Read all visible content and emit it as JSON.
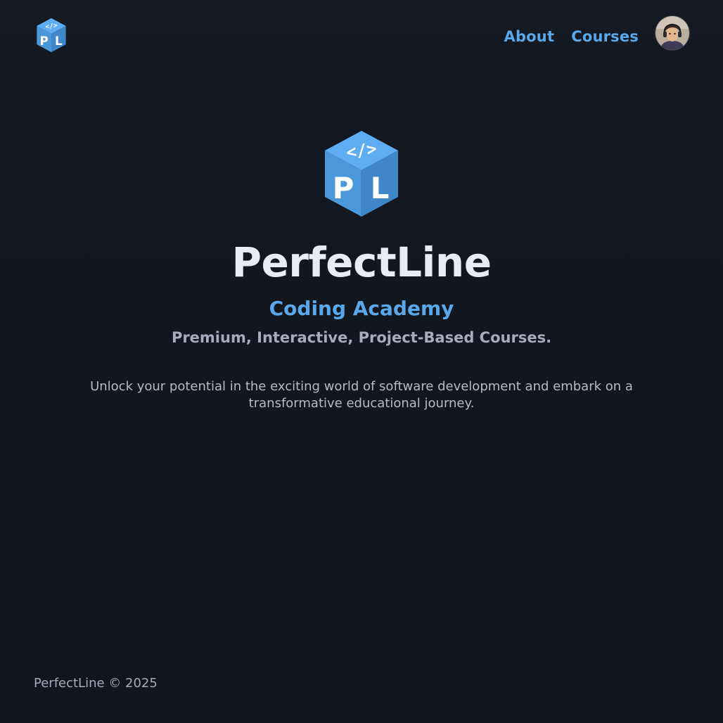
{
  "header": {
    "logo_icon": "perfectline-cube-logo",
    "nav": [
      {
        "label": "About"
      },
      {
        "label": "Courses"
      }
    ],
    "avatar_icon": "user-avatar"
  },
  "hero": {
    "logo_icon": "perfectline-cube-logo",
    "title": "PerfectLine",
    "subtitle": "Coding Academy",
    "tagline": "Premium, Interactive, Project-Based Courses.",
    "description": "Unlock your potential in the exciting world of software development and embark on a transformative educational journey."
  },
  "footer": {
    "text": "PerfectLine © 2025"
  },
  "colors": {
    "background": "#13171f",
    "accent": "#5aa8ec",
    "cube_top": "#5aaaf0",
    "cube_left": "#4a93d6",
    "cube_right": "#3f86c6",
    "title": "#e9ecf3",
    "muted": "#a7abbb"
  }
}
